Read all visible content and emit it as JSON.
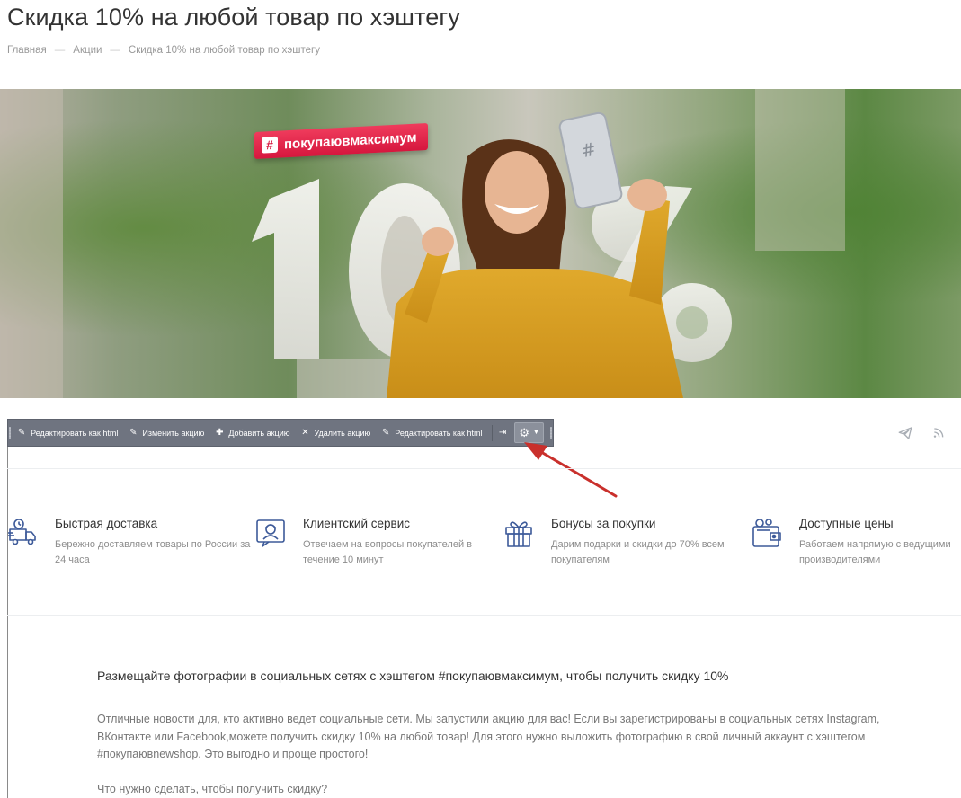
{
  "page": {
    "title": "Скидка 10% на любой товар по хэштегу",
    "breadcrumb": [
      "Главная",
      "Акции",
      "Скидка 10% на любой товар по хэштегу"
    ],
    "breadcrumb_separator": "—"
  },
  "banner": {
    "hashtag": "покупаювмаксимум",
    "hash_symbol": "#",
    "big_number": "10%"
  },
  "toolbar": {
    "edit_html_1": "Редактировать как html",
    "edit_action": "Изменить акцию",
    "add_action": "Добавить акцию",
    "delete_action": "Удалить акцию",
    "edit_html_2": "Редактировать как html",
    "pin_symbol": "⇥"
  },
  "features": [
    {
      "title": "Быстрая доставка",
      "desc": "Бережно доставляем товары по России за 24 часа",
      "icon": "delivery-truck-icon"
    },
    {
      "title": "Клиентский сервис",
      "desc": "Отвечаем на вопросы покупателей в течение 10 минут",
      "icon": "customer-service-icon"
    },
    {
      "title": "Бонусы за покупки",
      "desc": "Дарим подарки и скидки до 70% всем покупателям",
      "icon": "gift-icon"
    },
    {
      "title": "Доступные цены",
      "desc": "Работаем напрямую с ведущими производителями",
      "icon": "wallet-icon"
    }
  ],
  "content": {
    "lead": "Размещайте фотографии в социальных сетях с хэштегом #покупаювмаксимум, чтобы получить скидку 10%",
    "paragraph": "Отличные новости для, кто активно ведет социальные сети. Мы запустили акцию для вас! Если вы зарегистрированы в социальных сетях Instagram, ВКонтакте или Facebook,можете получить скидку 10% на любой товар! Для этого нужно выложить фотографию в свой личный аккаунт с хэштегом #покупаювnewshop. Это выгодно и проще простого!",
    "question": "Что нужно сделать, чтобы получить скидку?"
  },
  "colors": {
    "accent_icon": "#3d5a99",
    "badge": "#e0234a",
    "toolbar_bg": "#6f7480",
    "arrow": "#c9302c"
  }
}
